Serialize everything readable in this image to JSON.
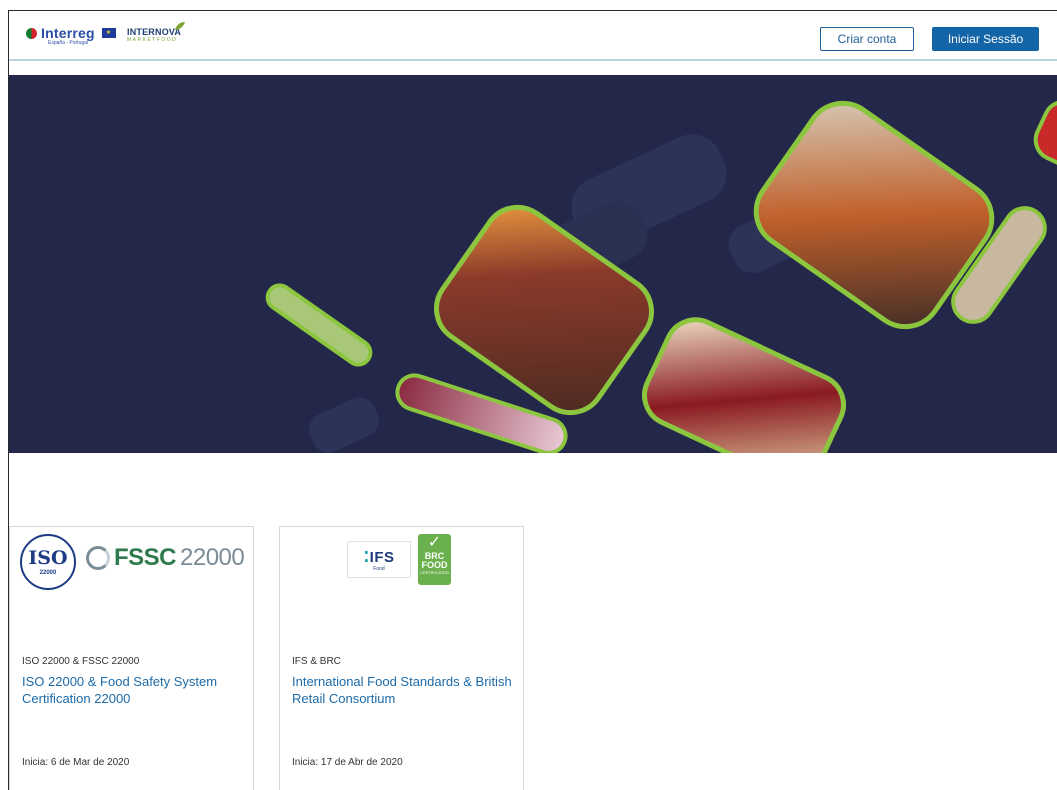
{
  "header": {
    "logo_interreg": {
      "word": "Interreg",
      "sub": "España - Portugal"
    },
    "logo_internova": {
      "word": "INTERNOVA",
      "sub": "MARKETFOOD"
    },
    "create_account_label": "Criar conta",
    "login_label": "Iniciar Sessão"
  },
  "colors": {
    "primary": "#1464a8",
    "hero_background": "#23284a",
    "accent_green": "#8cc63f",
    "title_link": "#1c6aa8"
  },
  "courses": [
    {
      "logo_iso": "ISO",
      "logo_iso_num": "22000",
      "logo_fssc": "FSSC",
      "logo_fssc_num": "22000",
      "category": "ISO 22000 & FSSC 22000",
      "title": "ISO 22000 & Food Safety System Certification 22000",
      "date": "Inicia: 6 de Mar de 2020"
    },
    {
      "logo_ifs": "IFS",
      "logo_ifs_sub": "Food",
      "logo_brc": "BRC",
      "logo_brc_food": "FOOD",
      "logo_brc_cert": "CERTIFICATED",
      "category": "IFS & BRC",
      "title": "International Food Standards & British Retail Consortium",
      "date": "Inicia: 17 de Abr de 2020"
    }
  ]
}
